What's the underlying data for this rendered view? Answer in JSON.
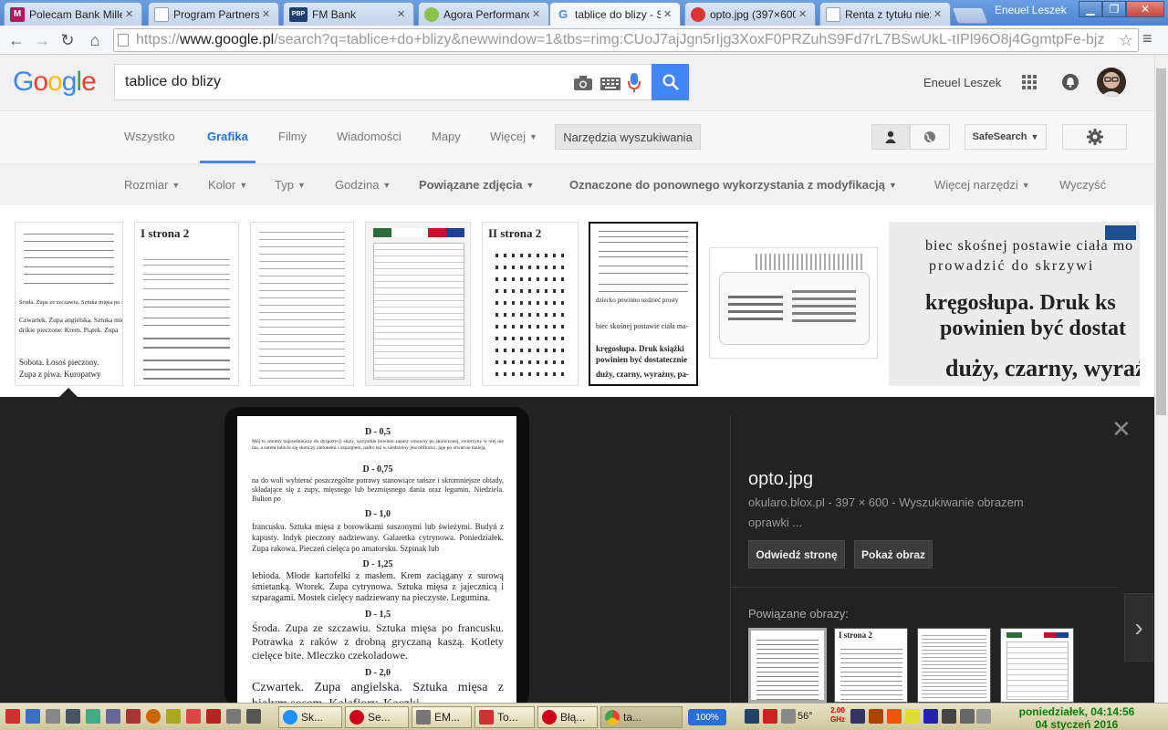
{
  "browser": {
    "tabs": [
      {
        "title": "Polecam Bank Millen",
        "favicon_text": "M",
        "favicon_color": "#b3165f"
      },
      {
        "title": "Program Partnerski",
        "favicon_text": "",
        "favicon_color": "#ffffff"
      },
      {
        "title": "FM Bank",
        "favicon_text": "PBP",
        "favicon_color": "#1d3f74"
      },
      {
        "title": "Agora Performance",
        "favicon_text": "",
        "favicon_color": "#8bc34a"
      },
      {
        "title": "tablice do blizy - Sz",
        "favicon_text": "G",
        "favicon_color": "#ffffff"
      },
      {
        "title": "opto.jpg (397×600",
        "favicon_text": "",
        "favicon_color": "#d33"
      },
      {
        "title": "Renta z tytułu niezd",
        "favicon_text": "",
        "favicon_color": "#ffffff"
      }
    ],
    "profile_name": "Eneuel Leszek",
    "url_prefix": "https://",
    "url_host": "www.google.pl",
    "url_path": "/search?q=tablice+do+blizy&newwindow=1&tbs=rimg:CUoJ7ajJgn5rIjg3XoxF0PRZuhS9Fd7rL7BSwUkL-tIPl96O8j4GgmtpFe-bjz"
  },
  "google": {
    "logo": "Google",
    "query": "tablice do blizy",
    "user_name": "Eneuel Leszek",
    "nav_tabs": [
      "Wszystko",
      "Grafika",
      "Filmy",
      "Wiadomości",
      "Mapy",
      "Więcej"
    ],
    "selected_tab": "Grafika",
    "tools_button": "Narzędzia wyszukiwania",
    "safesearch": "SafeSearch",
    "tools": [
      "Rozmiar",
      "Kolor",
      "Typ",
      "Godzina",
      "Powiązane zdjęcia",
      "Oznaczone do ponownego wykorzystania z modyfikacją",
      "Więcej narzędzi",
      "Wyczyść"
    ]
  },
  "thumbs": {
    "strona2_label": "strona 2",
    "strona2_label_b": "strona 2",
    "big_lines": [
      "biec skośnej postawie ciała mo",
      "prowadzić do skrzywi",
      "kręgosłupa. Druk ks",
      "powinien być dostat",
      "duży, czarny, wyraź"
    ],
    "thumb6_lines": [
      "dziecko powinno uzdzieć prosty",
      "biec skośnej postawie ciała ma-",
      "kręgosłupa. Druk książki",
      "powinien być dostatecznie",
      "duży, czarny, wyraźny, pa-"
    ],
    "thumb1_lines": [
      "Środa. Zupa ze szczawiu. Sztuka mięsa po fran-",
      "Czwartek. Zupa angielska. Sztuka mię-",
      "drikie pieczone. Krem. Piątek. Zupa",
      "Sobota. Łosoś pieczony.",
      "Zupa z piwa. Kuropatwy"
    ]
  },
  "preview": {
    "title": "opto.jpg",
    "source": "okularo.blox.pl",
    "dims": "397 × 600",
    "dash": "-",
    "meta_text": "Wyszukiwanie obrazem",
    "desc": "oprawki ...",
    "visit_btn": "Odwiedź stronę",
    "view_btn": "Pokaż obraz",
    "related_label": "Powiązane obrazy:",
    "related_strona": "strona 2",
    "doc": {
      "h1": "D - 0,5",
      "p1": "Mój to smutny najrzedniejszy do dyspozycji służy, wszystkie bowiem zapasy zmowny po skończonej, zwierzyny w niej nie ma, a zatem lubicie się skończy zielonemi i szpargiem, nadto też w niedzielny jest obfitości, jaje po otwarcie tanieją.",
      "h2": "D - 0,75",
      "p2": "na do woli wybierać poszczególne potrawy stanowiące tańsze i skromniejsze obiady, składające się z zupy, mięsnego lub bezmięsnego dania oraz legumin. Niedziela. Bulion po",
      "h3": "D - 1,0",
      "p3": "francusku. Sztuka mięsa z borowikami suszonymi lub świeżymi. Budyń z kapusty. Indyk pieczony nadziewany. Galaretka cytrynowa. Poniedziałek. Zupa rakowa. Pieczeń cielęca po amatorsku. Szpinak lub",
      "h4": "D - 1,25",
      "p4": "lebioda. Młode kartofelki z masłem. Krem zaciągany z surową śmietanką. Wtorek. Zupa cytrynowa. Sztuka mięsa z jajecznicą i szparagami. Mostek cielęcy nadziewany na pieczyste. Legumina.",
      "h5": "D - 1,5",
      "p5": "Środa. Zupa ze szczawiu. Sztuka mięsa po francusku. Potrawka z raków z drobną gryczaną kaszą. Kotlety cielęce bite. Mleczko czekoladowe.",
      "h6": "D - 2,0",
      "p6": "Czwartek. Zupa angielska. Sztuka mięsa z białym sosem. Kalafiory. Kaczki"
    }
  },
  "taskbar": {
    "tasks": [
      "Sk...",
      "Se...",
      "EM...",
      "To...",
      "Błą...",
      "ta..."
    ],
    "zoom_badge": "100%",
    "temp": "56°",
    "freq": "2.00 GHz",
    "clock_line1": "poniedziałek, 04:14:56",
    "clock_line2": "04 styczeń 2016"
  }
}
